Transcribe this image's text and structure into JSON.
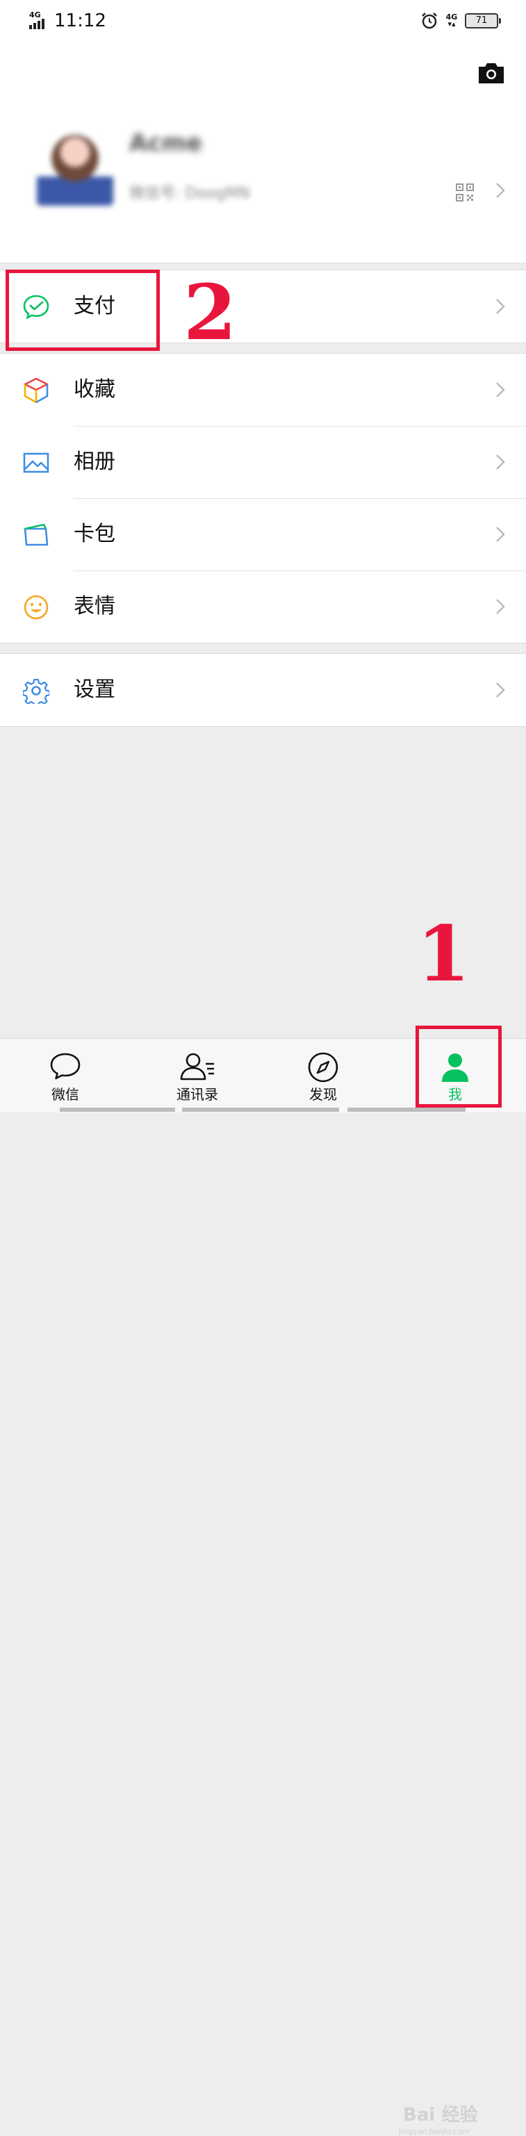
{
  "status_bar": {
    "network_left": "4G",
    "time": "11:12",
    "network_right": "4G",
    "battery": "71"
  },
  "profile": {
    "nickname": "Acme",
    "wechat_id": "微信号: DoogMN"
  },
  "menu": {
    "pay": "支付",
    "favorites": "收藏",
    "album": "相册",
    "cards": "卡包",
    "stickers": "表情",
    "settings": "设置"
  },
  "annotations": {
    "step1": "1",
    "step2": "2"
  },
  "tabbar": {
    "chats": "微信",
    "contacts": "通讯录",
    "discover": "发现",
    "me": "我"
  },
  "watermark": {
    "text": "Bai 经验",
    "sub": "jingyan.baidu.com"
  },
  "colors": {
    "accent_green": "#07c160",
    "annotation_red": "#e8163d"
  }
}
